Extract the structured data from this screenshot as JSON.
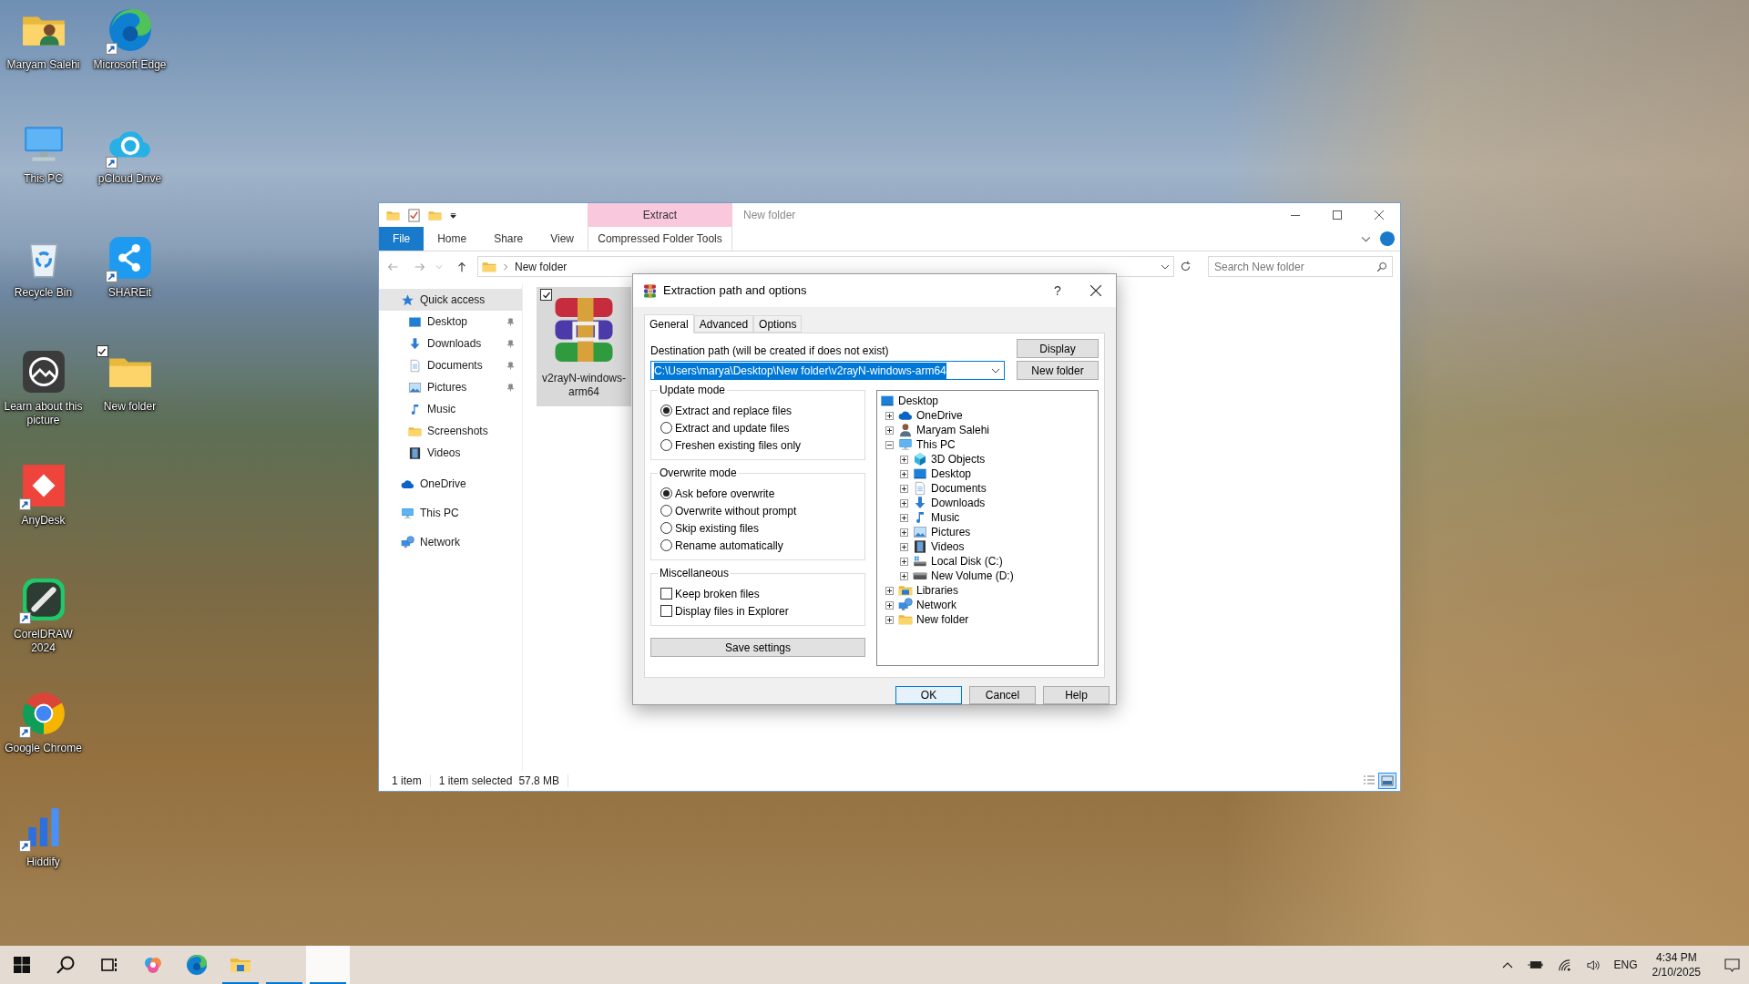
{
  "desktop": {
    "icons": [
      {
        "label": "Maryam Salehi",
        "kind": "user-folder",
        "shortcut": false,
        "checked": false
      },
      {
        "label": "This PC",
        "kind": "pc",
        "shortcut": false,
        "checked": false
      },
      {
        "label": "Recycle Bin",
        "kind": "recycle",
        "shortcut": false,
        "checked": false
      },
      {
        "label": "Learn about this picture",
        "kind": "learn",
        "shortcut": false,
        "checked": false
      },
      {
        "label": "AnyDesk",
        "kind": "anydesk",
        "shortcut": true,
        "checked": false
      },
      {
        "label": "CorelDRAW 2024",
        "kind": "coreldraw",
        "shortcut": true,
        "checked": false
      },
      {
        "label": "Google Chrome",
        "kind": "chrome",
        "shortcut": true,
        "checked": false
      },
      {
        "label": "Hiddify",
        "kind": "hiddify",
        "shortcut": true,
        "checked": false
      },
      {
        "label": "Microsoft Edge",
        "kind": "edge",
        "shortcut": true,
        "checked": false
      },
      {
        "label": "pCloud Drive",
        "kind": "pcloud",
        "shortcut": true,
        "checked": false
      },
      {
        "label": "SHAREit",
        "kind": "shareit",
        "shortcut": true,
        "checked": false
      },
      {
        "label": "New folder",
        "kind": "folder",
        "shortcut": false,
        "checked": true
      }
    ]
  },
  "explorer": {
    "title": "New folder",
    "context_group": "Extract",
    "ribbon_tabs": [
      {
        "label": "File",
        "kind": "file"
      },
      {
        "label": "Home",
        "kind": "tab"
      },
      {
        "label": "Share",
        "kind": "tab"
      },
      {
        "label": "View",
        "kind": "tab"
      },
      {
        "label": "Compressed Folder Tools",
        "kind": "context"
      }
    ],
    "address": "New folder",
    "search": {
      "placeholder": "Search New folder"
    },
    "nav": [
      {
        "label": "Quick access",
        "kind": "star",
        "selected": true,
        "children": [
          {
            "label": "Desktop",
            "kind": "desktop",
            "pinned": true,
            "selected": false
          },
          {
            "label": "Downloads",
            "kind": "downloads",
            "pinned": true,
            "selected": false
          },
          {
            "label": "Documents",
            "kind": "documents",
            "pinned": true,
            "selected": false
          },
          {
            "label": "Pictures",
            "kind": "pictures",
            "pinned": true,
            "selected": false
          },
          {
            "label": "Music",
            "kind": "music",
            "pinned": false,
            "selected": false
          },
          {
            "label": "Screenshots",
            "kind": "folder",
            "pinned": false,
            "selected": false
          },
          {
            "label": "Videos",
            "kind": "videos",
            "pinned": false,
            "selected": false
          }
        ]
      },
      {
        "label": "OneDrive",
        "kind": "cloud",
        "selected": false
      },
      {
        "label": "This PC",
        "kind": "pc",
        "selected": false
      },
      {
        "label": "Network",
        "kind": "network",
        "selected": false
      }
    ],
    "files": [
      {
        "name": "v2rayN-windows-arm64",
        "kind": "archive",
        "selected": true,
        "checked": true
      }
    ],
    "status": [
      "1 item",
      "1 item selected",
      "57.8 MB"
    ],
    "view_buttons": [
      {
        "kind": "details",
        "selected": false
      },
      {
        "kind": "large-icons",
        "selected": true
      }
    ]
  },
  "dialog": {
    "title": "Extraction path and options",
    "help": "?",
    "tabs": [
      {
        "label": "General",
        "selected": true
      },
      {
        "label": "Advanced",
        "selected": false
      },
      {
        "label": "Options",
        "selected": false
      }
    ],
    "destination": {
      "label": "Destination path (will be created if does not exist)",
      "value": "C:\\Users\\marya\\Desktop\\New folder\\v2rayN-windows-arm64",
      "selected": true
    },
    "side_buttons": [
      "Display",
      "New folder"
    ],
    "groups": [
      {
        "title": "Update mode",
        "kind": "radio",
        "options": [
          {
            "label": "Extract and replace files",
            "selected": true
          },
          {
            "label": "Extract and update files",
            "selected": false
          },
          {
            "label": "Freshen existing files only",
            "selected": false
          }
        ]
      },
      {
        "title": "Overwrite mode",
        "kind": "radio",
        "options": [
          {
            "label": "Ask before overwrite",
            "selected": true
          },
          {
            "label": "Overwrite without prompt",
            "selected": false
          },
          {
            "label": "Skip existing files",
            "selected": false
          },
          {
            "label": "Rename automatically",
            "selected": false
          }
        ]
      },
      {
        "title": "Miscellaneous",
        "kind": "checkbox",
        "options": [
          {
            "label": "Keep broken files",
            "checked": false
          },
          {
            "label": "Display files in Explorer",
            "checked": false
          }
        ]
      }
    ],
    "save_button": "Save settings",
    "tree": {
      "label": "Desktop",
      "kind": "desktop",
      "children": [
        {
          "label": "OneDrive",
          "kind": "cloud",
          "expanded": false
        },
        {
          "label": "Maryam Salehi",
          "kind": "user",
          "expanded": false
        },
        {
          "label": "This PC",
          "kind": "pc",
          "expanded": true,
          "children": [
            {
              "label": "3D Objects",
              "kind": "cube",
              "expanded": false
            },
            {
              "label": "Desktop",
              "kind": "desktop",
              "expanded": false
            },
            {
              "label": "Documents",
              "kind": "documents",
              "expanded": false
            },
            {
              "label": "Downloads",
              "kind": "downloads",
              "expanded": false
            },
            {
              "label": "Music",
              "kind": "music",
              "expanded": false
            },
            {
              "label": "Pictures",
              "kind": "pictures",
              "expanded": false
            },
            {
              "label": "Videos",
              "kind": "videos",
              "expanded": false
            },
            {
              "label": "Local Disk (C:)",
              "kind": "disk",
              "expanded": false
            },
            {
              "label": "New Volume (D:)",
              "kind": "drive",
              "expanded": false
            }
          ]
        },
        {
          "label": "Libraries",
          "kind": "libraries",
          "expanded": false
        },
        {
          "label": "Network",
          "kind": "network",
          "expanded": false
        },
        {
          "label": "New folder",
          "kind": "folder",
          "expanded": false
        }
      ]
    },
    "buttons": [
      {
        "label": "OK",
        "default": true
      },
      {
        "label": "Cancel",
        "default": false
      },
      {
        "label": "Help",
        "default": false
      }
    ]
  },
  "taskbar": {
    "apps": [
      {
        "kind": "windows",
        "running": false,
        "active": false
      },
      {
        "kind": "search",
        "running": false,
        "active": false
      },
      {
        "kind": "taskview",
        "running": false,
        "active": false
      },
      {
        "kind": "copilot",
        "running": false,
        "active": false
      },
      {
        "kind": "edge",
        "running": false,
        "active": false
      },
      {
        "kind": "explorer",
        "running": true,
        "active": false
      },
      {
        "kind": "blank",
        "running": true,
        "active": false
      },
      {
        "kind": "blank",
        "running": true,
        "active": true
      }
    ],
    "language": "ENG",
    "time": "4:34 PM",
    "date": "2/10/2025"
  }
}
